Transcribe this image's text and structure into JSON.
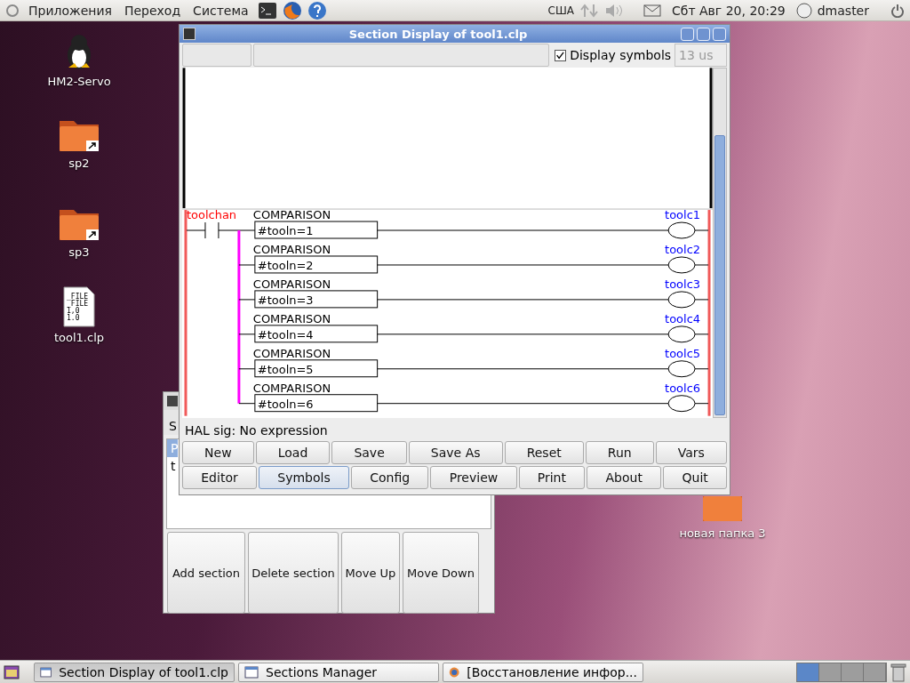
{
  "top_panel": {
    "menus": [
      "Приложения",
      "Переход",
      "Система"
    ],
    "keyboard_layout": "США",
    "clock": "Сбт Авг 20, 20:29",
    "user": "dmaster"
  },
  "desktop_icons": [
    {
      "label": "HM2-Servo",
      "kind": "penguin"
    },
    {
      "label": "sp2",
      "kind": "folder-link"
    },
    {
      "label": "sp3",
      "kind": "folder-link"
    },
    {
      "label": "tool1.clp",
      "kind": "file",
      "preview_lines": [
        "_FILE",
        "_FILE",
        "1,0",
        "1.0"
      ]
    },
    {
      "label": "новая папка 3",
      "kind": "folder"
    }
  ],
  "sections_manager": {
    "header_text": "S",
    "list_rows": [
      {
        "text": "P",
        "selected": true
      },
      {
        "text": "t",
        "selected": false
      }
    ],
    "buttons": [
      "Add section",
      "Delete section",
      "Move Up",
      "Move Down"
    ]
  },
  "main_window": {
    "title": "Section Display of tool1.clp",
    "toolbar": {
      "display_symbols": {
        "label": "Display symbols",
        "checked": true
      },
      "scan_time": "13 us"
    },
    "ladder": {
      "contact": "toolchan",
      "rungs": [
        {
          "block": "COMPARISON",
          "expression": "#tooln=1",
          "coil": "toolc1"
        },
        {
          "block": "COMPARISON",
          "expression": "#tooln=2",
          "coil": "toolc2"
        },
        {
          "block": "COMPARISON",
          "expression": "#tooln=3",
          "coil": "toolc3"
        },
        {
          "block": "COMPARISON",
          "expression": "#tooln=4",
          "coil": "toolc4"
        },
        {
          "block": "COMPARISON",
          "expression": "#tooln=5",
          "coil": "toolc5"
        },
        {
          "block": "COMPARISON",
          "expression": "#tooln=6",
          "coil": "toolc6"
        }
      ]
    },
    "status": "HAL sig: No expression",
    "button_rows": [
      [
        {
          "label": "New",
          "selected": false
        },
        {
          "label": "Load",
          "selected": false
        },
        {
          "label": "Save",
          "selected": false
        },
        {
          "label": "Save As",
          "selected": false
        },
        {
          "label": "Reset",
          "selected": false
        },
        {
          "label": "Run",
          "selected": false
        },
        {
          "label": "Vars",
          "selected": false
        }
      ],
      [
        {
          "label": "Editor",
          "selected": false
        },
        {
          "label": "Symbols",
          "selected": true
        },
        {
          "label": "Config",
          "selected": false
        },
        {
          "label": "Preview",
          "selected": false
        },
        {
          "label": "Print",
          "selected": false
        },
        {
          "label": "About",
          "selected": false
        },
        {
          "label": "Quit",
          "selected": false
        }
      ]
    ]
  },
  "taskbar": [
    {
      "label": "Section Display of tool1.clp",
      "kind": "window",
      "selected": true
    },
    {
      "label": "Sections Manager",
      "kind": "window",
      "selected": false
    },
    {
      "label": "[Восстановление инфор...",
      "kind": "browser",
      "selected": false
    }
  ]
}
